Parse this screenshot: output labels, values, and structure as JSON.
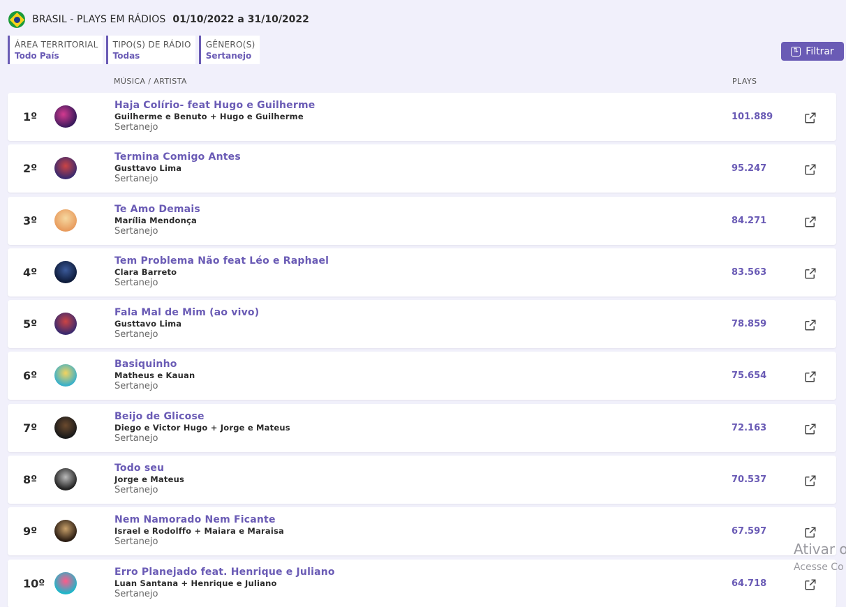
{
  "header": {
    "title": "BRASIL - PLAYS EM RÁDIOS",
    "period": "01/10/2022 a 31/10/2022",
    "flag_icon": "brazil-flag-icon"
  },
  "filters": [
    {
      "label": "ÁREA TERRITORIAL",
      "value": "Todo País"
    },
    {
      "label": "TIPO(S) DE RÁDIO",
      "value": "Todas"
    },
    {
      "label": "GÊNERO(S)",
      "value": "Sertanejo"
    }
  ],
  "filter_button": {
    "label": "Filtrar",
    "icon": "sort-arrows-icon"
  },
  "columns": {
    "music_artist": "MÚSICA / ARTISTA",
    "plays": "PLAYS"
  },
  "colors": {
    "accent": "#6a5bb5",
    "background": "#f1f0fb"
  },
  "rows": [
    {
      "rank": "1º",
      "title": "Haja Colírio- feat Hugo e Guilherme",
      "artist": "Guilherme e Benuto + Hugo e Guilherme",
      "genre": "Sertanejo",
      "plays": "101.889"
    },
    {
      "rank": "2º",
      "title": "Termina Comigo Antes",
      "artist": "Gusttavo Lima",
      "genre": "Sertanejo",
      "plays": "95.247"
    },
    {
      "rank": "3º",
      "title": "Te Amo Demais",
      "artist": "Marília Mendonça",
      "genre": "Sertanejo",
      "plays": "84.271"
    },
    {
      "rank": "4º",
      "title": "Tem Problema Não feat Léo e Raphael",
      "artist": "Clara Barreto",
      "genre": "Sertanejo",
      "plays": "83.563"
    },
    {
      "rank": "5º",
      "title": "Fala Mal de Mim (ao vivo)",
      "artist": "Gusttavo Lima",
      "genre": "Sertanejo",
      "plays": "78.859"
    },
    {
      "rank": "6º",
      "title": "Basiquinho",
      "artist": "Matheus e Kauan",
      "genre": "Sertanejo",
      "plays": "75.654"
    },
    {
      "rank": "7º",
      "title": "Beijo de Glicose",
      "artist": "Diego e Victor Hugo + Jorge e Mateus",
      "genre": "Sertanejo",
      "plays": "72.163"
    },
    {
      "rank": "8º",
      "title": "Todo seu",
      "artist": "Jorge e Mateus",
      "genre": "Sertanejo",
      "plays": "70.537"
    },
    {
      "rank": "9º",
      "title": "Nem Namorado Nem Ficante",
      "artist": "Israel e Rodolffo + Maiara e Maraisa",
      "genre": "Sertanejo",
      "plays": "67.597"
    },
    {
      "rank": "10º",
      "title": "Erro Planejado feat. Henrique e Juliano",
      "artist": "Luan Santana + Henrique e Juliano",
      "genre": "Sertanejo",
      "plays": "64.718"
    }
  ],
  "row_icon": "external-link-icon",
  "watermark": {
    "line1": "Ativar o",
    "line2": "Acesse Co"
  }
}
